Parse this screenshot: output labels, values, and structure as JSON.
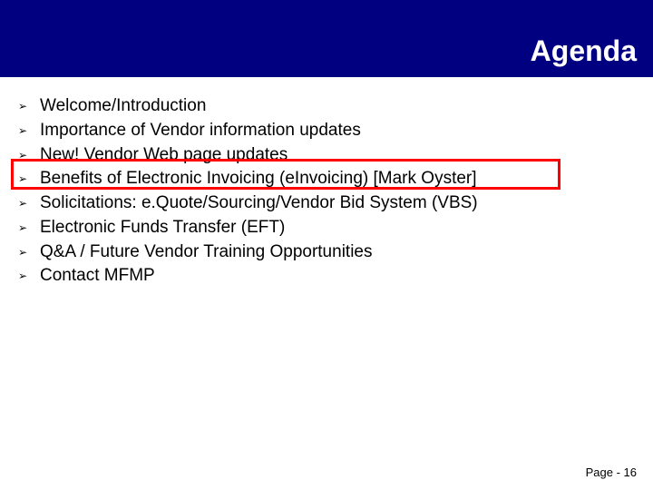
{
  "title": "Agenda",
  "items": [
    {
      "text": "Welcome/Introduction"
    },
    {
      "text": "Importance of Vendor information updates"
    },
    {
      "text": "New! Vendor Web page updates"
    },
    {
      "text": "Benefits of Electronic Invoicing (eInvoicing) [Mark Oyster]"
    },
    {
      "text": "Solicitations: e.Quote/Sourcing/Vendor Bid System (VBS)"
    },
    {
      "text": "Electronic Funds Transfer (EFT)"
    },
    {
      "text": "Q&A / Future Vendor Training Opportunities"
    },
    {
      "text": "Contact MFMP"
    }
  ],
  "highlight_index": 3,
  "footer": "Page - 16",
  "bullet_glyph": "➢"
}
